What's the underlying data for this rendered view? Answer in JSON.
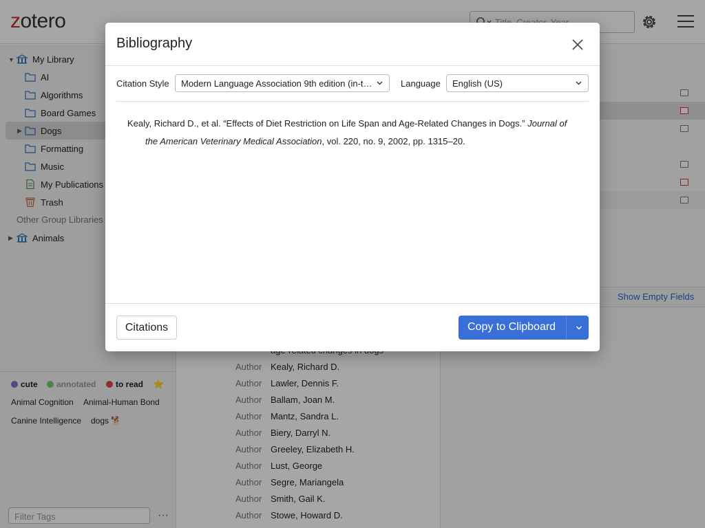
{
  "app": {
    "logo_prefix": "z",
    "logo_rest": "otero",
    "search_placeholder": "Title, Creator, Year",
    "icons": {
      "search": "search-icon",
      "settings": "gear-icon",
      "menu": "hamburger-icon"
    }
  },
  "collections": {
    "my_library": "My Library",
    "items": [
      "AI",
      "Algorithms",
      "Board Games",
      "Dogs",
      "Formatting",
      "Music",
      "My Publications",
      "Trash"
    ],
    "other_group_label": "Other Group Libraries",
    "group": "Animals"
  },
  "tags": {
    "colored": [
      {
        "label": "cute",
        "color": "#8a6ad1"
      },
      {
        "label": "annotated",
        "color": "#7cc576"
      },
      {
        "label": "to read",
        "color": "#d94848"
      }
    ],
    "emoji_tag": "⭐",
    "plain": [
      "Animal Cognition",
      "Animal-Human Bond",
      "Canine Intelligence",
      "dogs 🐕"
    ],
    "filter_placeholder": "Filter Tags",
    "menu_label": "···"
  },
  "item_pane": {
    "cut_text": "age-related changes in dogs",
    "author_label": "Author",
    "authors": [
      "Kealy, Richard D.",
      "Lawler, Dennis F.",
      "Ballam, Joan M.",
      "Mantz, Sandra L.",
      "Biery, Darryl N.",
      "Greeley, Elizabeth H.",
      "Lust, George",
      "Segre, Mariangela",
      "Smith, Gail K.",
      "Stowe, Howard D."
    ],
    "show_empty_fields": "Show Empty Fields"
  },
  "dialog": {
    "title": "Bibliography",
    "citation_style_label": "Citation Style",
    "citation_style_value": "Modern Language Association 9th edition (in-t…",
    "language_label": "Language",
    "language_value": "English (US)",
    "entry": {
      "plain": "Kealy, Richard D., et al. “Effects of Diet Restriction on Life Span and Age-Related Changes in Dogs.” ",
      "journal": "Journal of the American Veterinary Medical Association",
      "rest": ", vol. 220, no. 9, 2002, pp. 1315–20."
    },
    "citations_button": "Citations",
    "copy_button": "Copy to Clipboard"
  }
}
